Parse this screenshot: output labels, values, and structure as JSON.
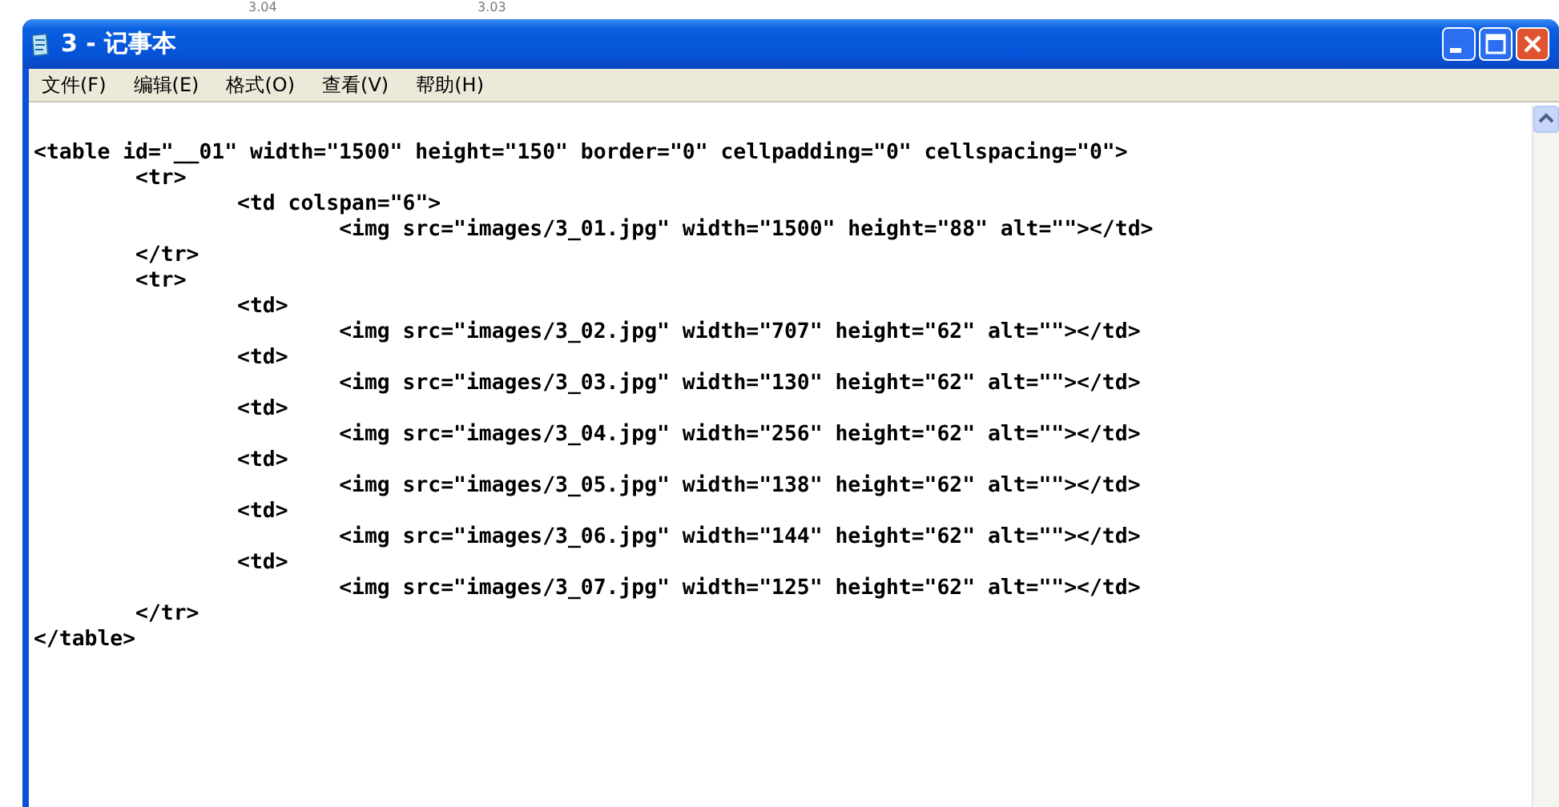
{
  "background_labels": [
    "3.04",
    "3.03"
  ],
  "window": {
    "title": "3 - 记事本"
  },
  "menu": [
    "文件(F)",
    "编辑(E)",
    "格式(O)",
    "查看(V)",
    "帮助(H)"
  ],
  "lines": [
    "<table id=\"__01\" width=\"1500\" height=\"150\" border=\"0\" cellpadding=\"0\" cellspacing=\"0\">",
    "\t<tr>",
    "\t\t<td colspan=\"6\">",
    "\t\t\t<img src=\"images/3_01.jpg\" width=\"1500\" height=\"88\" alt=\"\"></td>",
    "\t</tr>",
    "\t<tr>",
    "\t\t<td>",
    "\t\t\t<img src=\"images/3_02.jpg\" width=\"707\" height=\"62\" alt=\"\"></td>",
    "\t\t<td>",
    "\t\t\t<img src=\"images/3_03.jpg\" width=\"130\" height=\"62\" alt=\"\"></td>",
    "\t\t<td>",
    "\t\t\t<img src=\"images/3_04.jpg\" width=\"256\" height=\"62\" alt=\"\"></td>",
    "\t\t<td>",
    "\t\t\t<img src=\"images/3_05.jpg\" width=\"138\" height=\"62\" alt=\"\"></td>",
    "\t\t<td>",
    "\t\t\t<img src=\"images/3_06.jpg\" width=\"144\" height=\"62\" alt=\"\"></td>",
    "\t\t<td>",
    "\t\t\t<img src=\"images/3_07.jpg\" width=\"125\" height=\"62\" alt=\"\"></td>",
    "\t</tr>",
    "</table>"
  ]
}
